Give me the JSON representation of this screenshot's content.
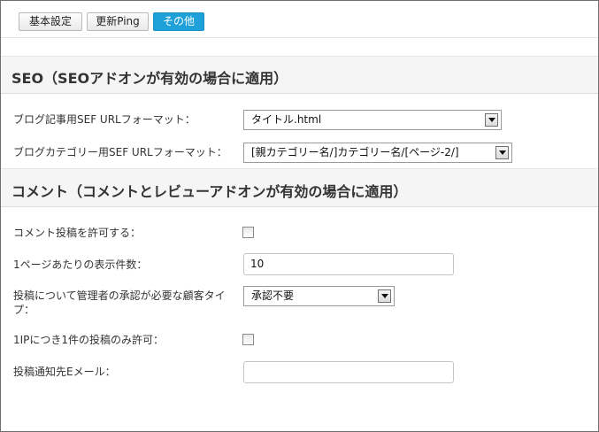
{
  "tabs": [
    {
      "label": "基本設定"
    },
    {
      "label": "更新Ping"
    },
    {
      "label": "その他"
    }
  ],
  "seo": {
    "title": "SEO（SEOアドオンが有効の場合に適用）",
    "blog_article_sef": {
      "label": "ブログ記事用SEF URLフォーマット：",
      "value": "タイトル.html"
    },
    "blog_category_sef": {
      "label": "ブログカテゴリー用SEF URLフォーマット：",
      "value": "[親カテゴリー名/]カテゴリー名/[ページ-2/]"
    }
  },
  "comment": {
    "title": "コメント（コメントとレビューアドオンが有効の場合に適用）",
    "allow_comments": {
      "label": "コメント投稿を許可する：",
      "checked": false
    },
    "per_page": {
      "label": "1ページあたりの表示件数：",
      "value": "10"
    },
    "approval_customer_type": {
      "label": "投稿について管理者の承認が必要な顧客タイプ：",
      "value": "承認不要"
    },
    "one_per_ip": {
      "label": "1IPにつき1件の投稿のみ許可：",
      "checked": false
    },
    "notify_email": {
      "label": "投稿通知先Eメール：",
      "value": ""
    }
  }
}
